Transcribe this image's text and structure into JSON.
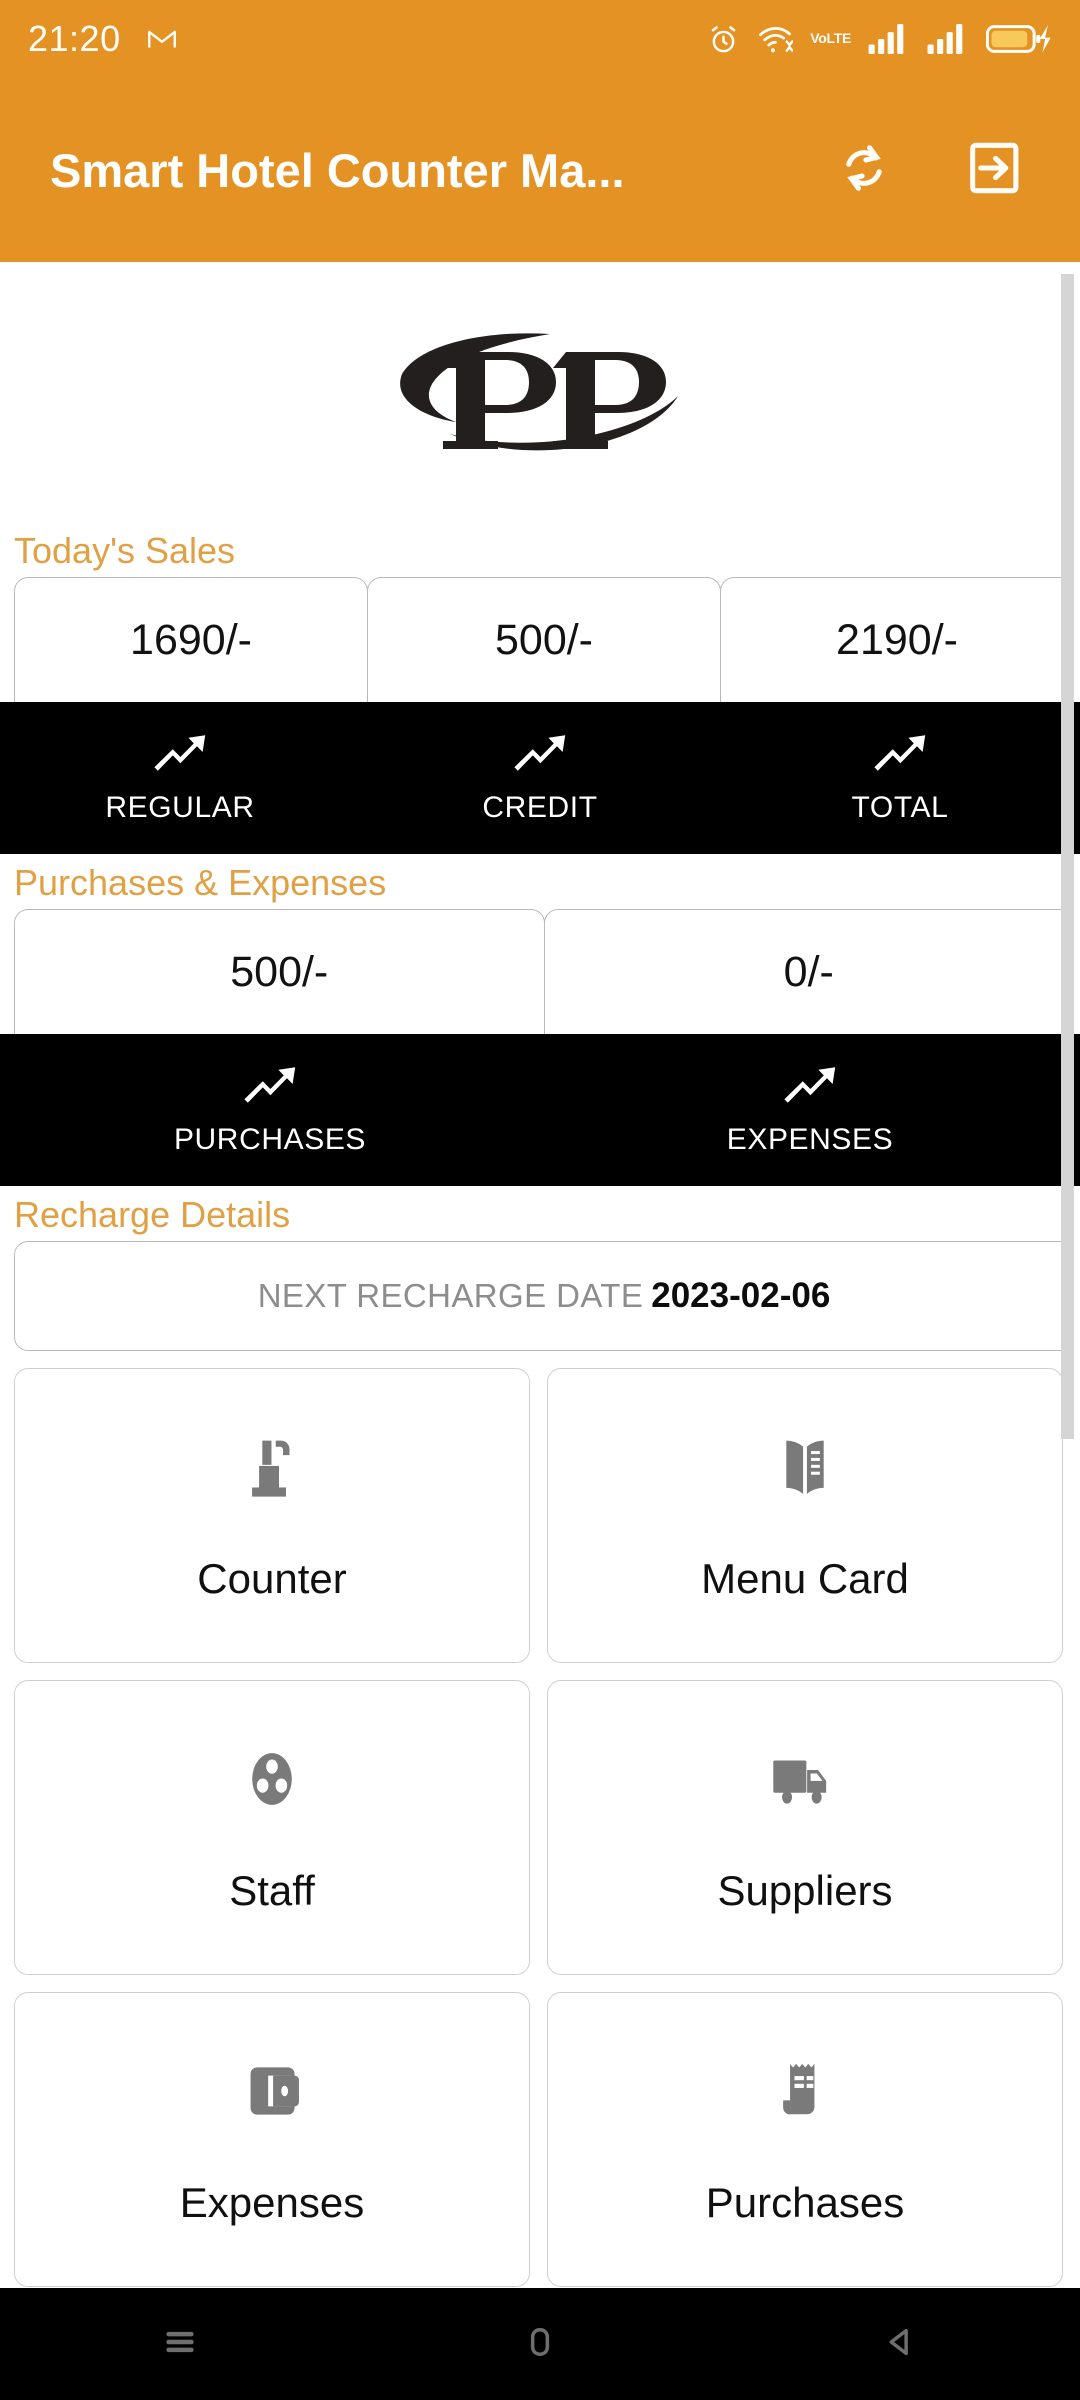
{
  "status_bar": {
    "time": "21:20",
    "icons": [
      "gmail-icon",
      "alarm-icon",
      "wifi-icon",
      "volte-icon",
      "signal-icon-sim1",
      "signal-icon-sim2",
      "battery-charging-icon"
    ],
    "volte_top": "Vo",
    "volte_bottom": "LTE"
  },
  "app_bar": {
    "title": "Smart Hotel Counter Ma...",
    "actions": [
      {
        "name": "sync-button",
        "icon": "sync-refresh-icon"
      },
      {
        "name": "logout-button",
        "icon": "logout-arrow-icon"
      }
    ]
  },
  "logo": {
    "text": "PP",
    "alt": "PP brand logo"
  },
  "sales": {
    "title": "Today's Sales",
    "items": [
      {
        "value": "1690/-",
        "label": "REGULAR",
        "icon": "trending-up-icon"
      },
      {
        "value": "500/-",
        "label": "CREDIT",
        "icon": "trending-up-icon"
      },
      {
        "value": "2190/-",
        "label": "TOTAL",
        "icon": "trending-up-icon"
      }
    ]
  },
  "purchases_expenses": {
    "title": "Purchases & Expenses",
    "items": [
      {
        "value": "500/-",
        "label": "PURCHASES",
        "icon": "trending-up-icon"
      },
      {
        "value": "0/-",
        "label": "EXPENSES",
        "icon": "trending-up-icon"
      }
    ]
  },
  "recharge": {
    "title": "Recharge Details",
    "label": "NEXT RECHARGE DATE",
    "date": "2023-02-06"
  },
  "tiles": [
    {
      "label": "Counter",
      "icon": "podium-icon"
    },
    {
      "label": "Menu Card",
      "icon": "open-book-icon"
    },
    {
      "label": "Staff",
      "icon": "group-people-icon"
    },
    {
      "label": "Suppliers",
      "icon": "delivery-truck-icon"
    },
    {
      "label": "Expenses",
      "icon": "wallet-icon"
    },
    {
      "label": "Purchases",
      "icon": "receipt-icon"
    }
  ],
  "nav_bar": {
    "buttons": [
      {
        "name": "recents-button",
        "icon": "hamburger-menu-icon"
      },
      {
        "name": "home-button",
        "icon": "home-square-icon"
      },
      {
        "name": "back-button",
        "icon": "back-triangle-icon"
      }
    ]
  },
  "colors": {
    "brand_orange": "#e59225",
    "section_title": "#e0a044",
    "strip_black": "#000000",
    "icon_gray": "#7a7a7a"
  }
}
